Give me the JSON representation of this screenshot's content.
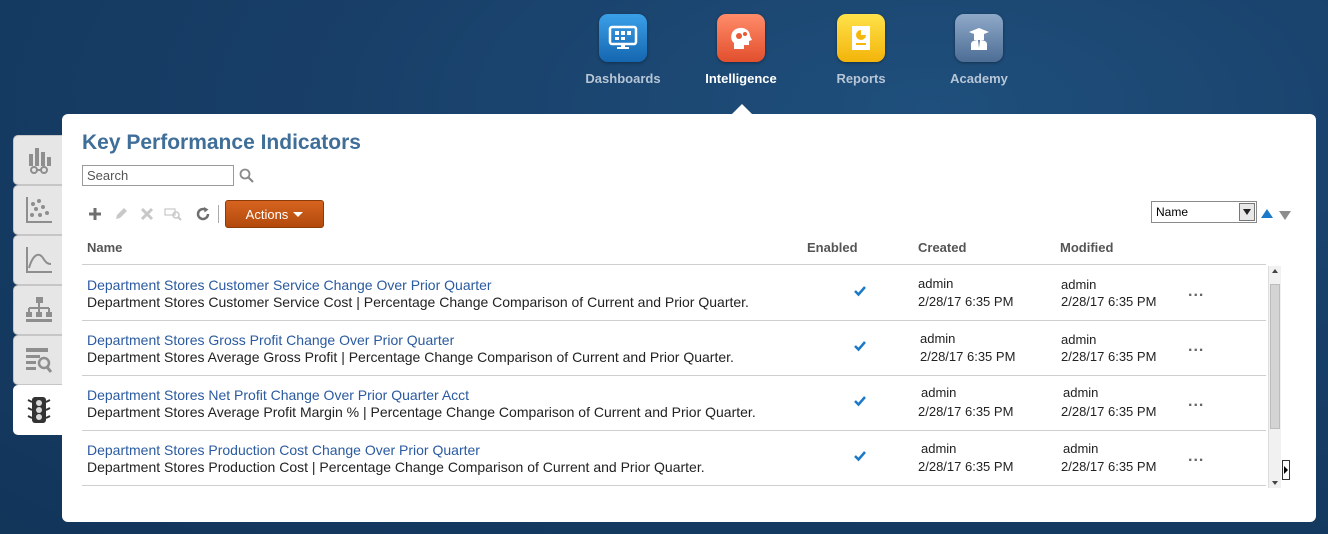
{
  "nav": {
    "items": [
      {
        "label": "Dashboards",
        "icon": "monitor-icon"
      },
      {
        "label": "Intelligence",
        "icon": "head-gears-icon"
      },
      {
        "label": "Reports",
        "icon": "report-icon"
      },
      {
        "label": "Academy",
        "icon": "graduate-icon"
      }
    ],
    "active": "Intelligence"
  },
  "side_tabs": [
    "bar-chart-glasses-icon",
    "scatter-chart-icon",
    "line-chart-icon",
    "hierarchy-icon",
    "list-search-icon",
    "traffic-light-icon"
  ],
  "panel": {
    "title": "Key Performance Indicators",
    "search": {
      "placeholder": "Search",
      "value": ""
    },
    "actions_label": "Actions",
    "sort": {
      "selected": "Name"
    },
    "columns": {
      "name": "Name",
      "enabled": "Enabled",
      "created": "Created",
      "modified": "Modified"
    },
    "rows": [
      {
        "name": "Department Stores Customer Service Change Over Prior Quarter",
        "description": "Department Stores Customer Service Cost | Percentage Change Comparison of Current and Prior Quarter.",
        "enabled": true,
        "created_by": "admin",
        "created_date": "2/28/17 6:35 PM",
        "modified_by": "admin",
        "modified_date": "2/28/17 6:35 PM",
        "more": "..."
      },
      {
        "name": "Department Stores Gross Profit Change Over Prior Quarter",
        "description": "Department Stores Average Gross Profit | Percentage Change Comparison of Current and Prior Quarter.",
        "enabled": true,
        "created_by": "admin",
        "created_date": "2/28/17 6:35 PM",
        "modified_by": "admin",
        "modified_date": "2/28/17 6:35 PM",
        "more": "..."
      },
      {
        "name": "Department Stores Net Profit Change Over Prior Quarter Acct",
        "description": "Department Stores Average Profit Margin % | Percentage Change Comparison of Current and Prior Quarter.",
        "enabled": true,
        "created_by": "admin",
        "created_date": "2/28/17 6:35 PM",
        "modified_by": "admin",
        "modified_date": "2/28/17 6:35 PM",
        "more": "..."
      },
      {
        "name": "Department Stores Production Cost Change Over Prior Quarter",
        "description": "Department Stores Production Cost | Percentage Change Comparison of Current and Prior Quarter.",
        "enabled": true,
        "created_by": "admin",
        "created_date": "2/28/17 6:35 PM",
        "modified_by": "admin",
        "modified_date": "2/28/17 6:35 PM",
        "more": "..."
      }
    ]
  },
  "colors": {
    "background": "#173e66",
    "title": "#3f6e99",
    "link": "#2a5aa0",
    "actions": "#c0561a",
    "check": "#1a7ac9"
  }
}
